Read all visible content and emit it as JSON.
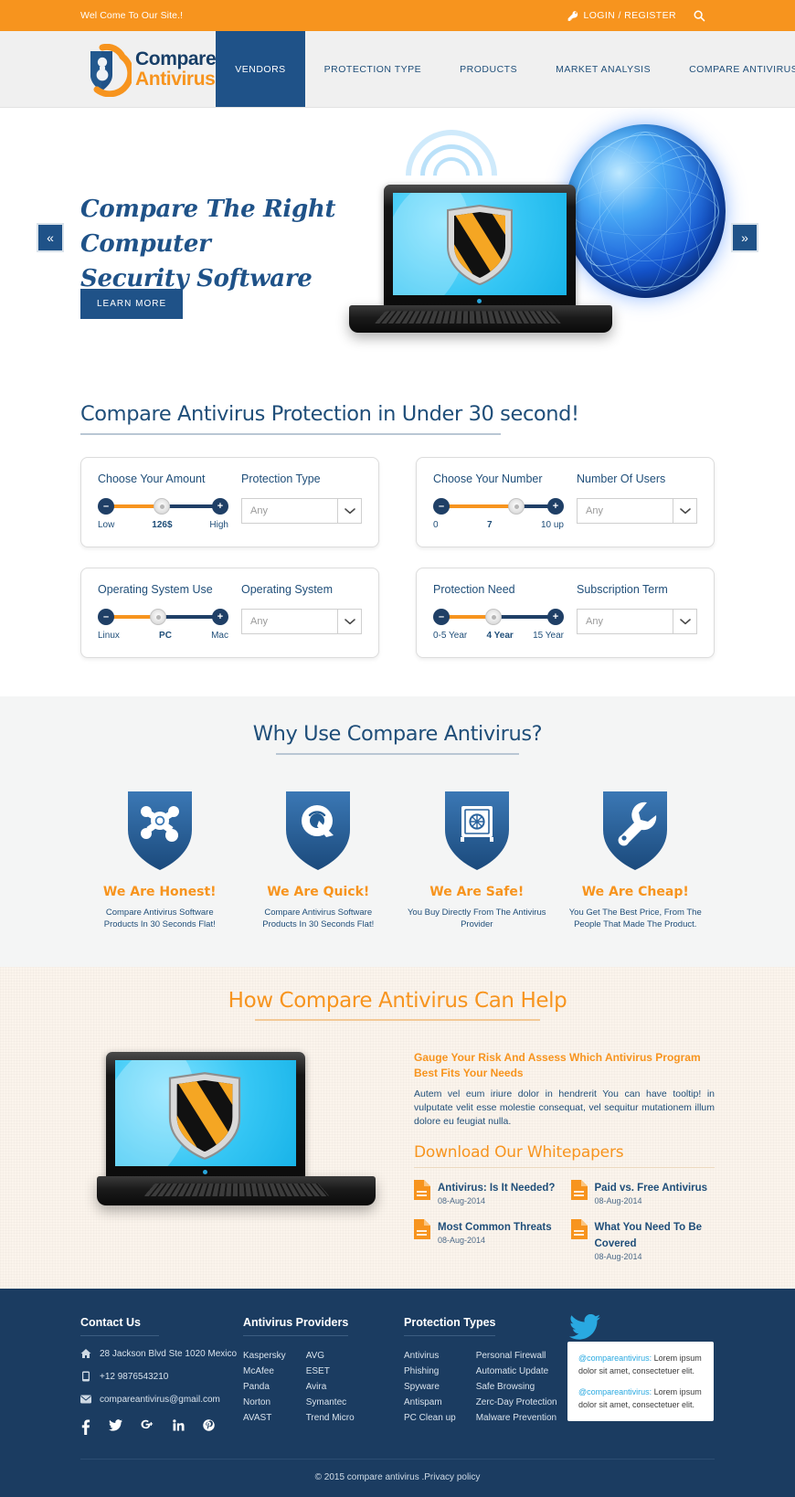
{
  "topbar": {
    "welcome": "Wel Come To Our Site.!",
    "login_label": "LOGIN / REGISTER",
    "key_icon": "key-icon",
    "search_icon": "search-icon"
  },
  "header": {
    "logo_line1": "Compare",
    "logo_line2": "Antivirus",
    "nav": [
      {
        "label": "VENDORS",
        "active": true
      },
      {
        "label": "PROTECTION TYPE",
        "active": false
      },
      {
        "label": "PRODUCTS",
        "active": false
      },
      {
        "label": "MARKET ANALYSIS",
        "active": false
      },
      {
        "label": "COMPARE ANTIVIRUS",
        "active": false
      }
    ]
  },
  "hero": {
    "title_line1": "Compare The Right Computer",
    "title_line2": "Security Software",
    "cta": "LEARN MORE",
    "prev": "«",
    "next": "»"
  },
  "filters": {
    "section_title": "Compare Antivirus Protection in Under 30 second!",
    "cards": [
      {
        "slider_label": "Choose Your Amount",
        "scale_low": "Low",
        "scale_mid": "126$",
        "scale_high": "High",
        "fill_pct": 46,
        "knob_pct": 46,
        "select_label": "Protection Type",
        "select_value": "Any"
      },
      {
        "slider_label": "Choose Your Number",
        "scale_low": "0",
        "scale_mid": "7",
        "scale_high": "10 up",
        "fill_pct": 60,
        "knob_pct": 60,
        "select_label": "Number Of Users",
        "select_value": "Any"
      },
      {
        "slider_label": "Operating System Use",
        "scale_low": "Linux",
        "scale_mid": "PC",
        "scale_high": "Mac",
        "fill_pct": 42,
        "knob_pct": 42,
        "select_label": "Operating System",
        "select_value": "Any"
      },
      {
        "slider_label": "Protection Need",
        "scale_low": "0-5 Year",
        "scale_mid": "4 Year",
        "scale_high": "15 Year",
        "fill_pct": 42,
        "knob_pct": 42,
        "select_label": "Subscription Term",
        "select_value": "Any"
      }
    ],
    "minus": "–",
    "plus": "+"
  },
  "why": {
    "title": "Why Use Compare Antivirus?",
    "items": [
      {
        "icon": "virus-shield-icon",
        "title": "We Are Honest!",
        "desc": "Compare Antivirus Software Products In 30 Seconds Flat!"
      },
      {
        "icon": "quicktime-shield-icon",
        "title": "We Are Quick!",
        "desc": "Compare Antivirus Software Products In 30 Seconds Flat!"
      },
      {
        "icon": "safe-vault-shield-icon",
        "title": "We Are Safe!",
        "desc": "You Buy Directly From The Antivirus Provider"
      },
      {
        "icon": "wrench-shield-icon",
        "title": "We Are Cheap!",
        "desc": "You Get  The Best Price, From The People That Made The Product."
      }
    ]
  },
  "how": {
    "title": "How Compare Antivirus Can Help",
    "subtitle": "Gauge Your Risk And Assess Which Antivirus Program Best Fits Your Needs",
    "paragraph": "Autem vel eum iriure dolor in hendrerit You can have tooltip! in vulputate velit esse molestie consequat, vel sequitur mutationem illum dolore eu feugiat nulla.",
    "whitepapers_title": "Download Our Whitepapers",
    "whitepapers": [
      {
        "name": "Antivirus: Is It Needed?",
        "date": "08-Aug-2014"
      },
      {
        "name": "Paid vs. Free Antivirus",
        "date": "08-Aug-2014"
      },
      {
        "name": "Most Common Threats",
        "date": "08-Aug-2014"
      },
      {
        "name": "What You Need To Be Covered",
        "date": "08-Aug-2014"
      }
    ]
  },
  "footer": {
    "contact": {
      "title": "Contact Us",
      "address": "28 Jackson Blvd Ste 1020 Mexico",
      "phone": "+12 9876543210",
      "email": "compareantivirus@gmail.com",
      "social": [
        "facebook-icon",
        "twitter-icon",
        "google-plus-icon",
        "linkedin-icon",
        "pinterest-icon"
      ]
    },
    "providers": {
      "title": "Antivirus Providers",
      "col1": [
        "Kaspersky",
        "McAfee",
        "Panda",
        "Norton",
        "AVAST"
      ],
      "col2": [
        "AVG",
        "ESET",
        "Avira",
        "Symantec",
        "Trend Micro"
      ]
    },
    "protection": {
      "title": "Protection Types",
      "col1": [
        "Antivirus",
        "Phishing",
        "Spyware",
        "Antispam",
        "PC Clean up"
      ],
      "col2": [
        "Personal Firewall",
        "Automatic Update",
        "Safe Browsing",
        "Zerc-Day Protection",
        "Malware Prevention"
      ]
    },
    "tweets": [
      {
        "handle": "@compareantivirus:",
        "text": " Lorem ipsum dolor sit amet, consectetuer  elit."
      },
      {
        "handle": "@compareantivirus:",
        "text": " Lorem ipsum dolor sit amet, consectetuer  elit."
      }
    ],
    "copyright": "© 2015 compare antivirus .Privacy policy"
  },
  "colors": {
    "orange": "#f7941e",
    "navy": "#1f5288",
    "dark_navy": "#1b3c61",
    "text_blue": "#1f4e79",
    "twitter_blue": "#29a9e1"
  }
}
